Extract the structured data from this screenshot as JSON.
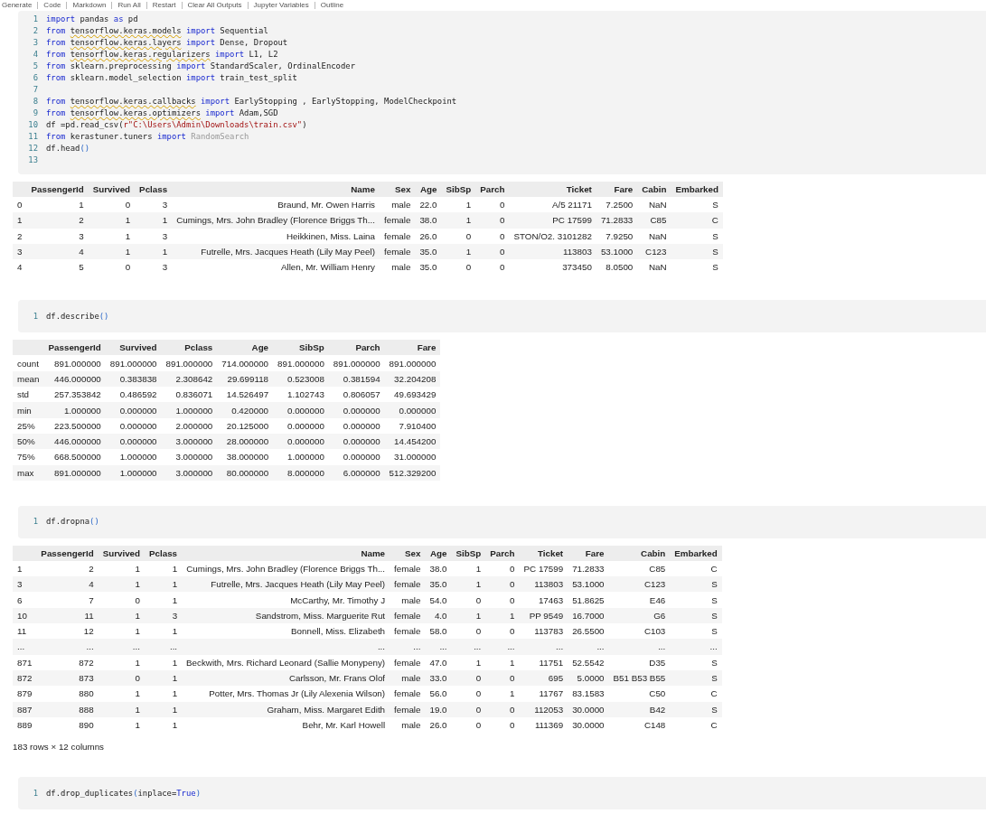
{
  "toolbar": {
    "items": [
      "Generate",
      "Code",
      "Markdown",
      "Run All",
      "Restart",
      "Clear All Outputs",
      "Jupyter Variables",
      "Outline"
    ]
  },
  "cells": [
    {
      "code_lines": [
        {
          "number": "1",
          "tokens": [
            {
              "kind": "kw",
              "text": "import"
            },
            {
              "kind": "plain",
              "text": " pandas "
            },
            {
              "kind": "kw",
              "text": "as"
            },
            {
              "kind": "plain",
              "text": " pd"
            }
          ]
        },
        {
          "number": "2",
          "tokens": [
            {
              "kind": "kw",
              "text": "from "
            },
            {
              "kind": "warn",
              "text": "tensorflow.keras.models"
            },
            {
              "kind": "kw",
              "text": " import"
            },
            {
              "kind": "plain",
              "text": " Sequential"
            }
          ]
        },
        {
          "number": "3",
          "tokens": [
            {
              "kind": "kw",
              "text": "from "
            },
            {
              "kind": "warn",
              "text": "tensorflow.keras.layers"
            },
            {
              "kind": "kw",
              "text": " import"
            },
            {
              "kind": "plain",
              "text": " Dense, Dropout"
            }
          ]
        },
        {
          "number": "4",
          "tokens": [
            {
              "kind": "kw",
              "text": "from "
            },
            {
              "kind": "warn",
              "text": "tensorflow.keras.regularizers"
            },
            {
              "kind": "kw",
              "text": " import"
            },
            {
              "kind": "plain",
              "text": " L1, L2"
            }
          ]
        },
        {
          "number": "5",
          "tokens": [
            {
              "kind": "kw",
              "text": "from"
            },
            {
              "kind": "plain",
              "text": " sklearn.preprocessing "
            },
            {
              "kind": "kw",
              "text": "import"
            },
            {
              "kind": "plain",
              "text": " StandardScaler, OrdinalEncoder"
            }
          ]
        },
        {
          "number": "6",
          "tokens": [
            {
              "kind": "kw",
              "text": "from"
            },
            {
              "kind": "plain",
              "text": " sklearn.model_selection "
            },
            {
              "kind": "kw",
              "text": "import"
            },
            {
              "kind": "plain",
              "text": " train_test_split"
            }
          ]
        },
        {
          "number": "7"
        },
        {
          "number": "8",
          "tokens": [
            {
              "kind": "kw",
              "text": "from "
            },
            {
              "kind": "warn",
              "text": "tensorflow.keras.callbacks"
            },
            {
              "kind": "kw",
              "text": " import"
            },
            {
              "kind": "plain",
              "text": " EarlyStopping , EarlyStopping, ModelCheckpoint"
            }
          ]
        },
        {
          "number": "9",
          "tokens": [
            {
              "kind": "kw",
              "text": "from "
            },
            {
              "kind": "warn",
              "text": "tensorflow.keras.optimizers"
            },
            {
              "kind": "kw",
              "text": " import"
            },
            {
              "kind": "plain",
              "text": " Adam,SGD"
            }
          ]
        },
        {
          "number": "10",
          "tokens": [
            {
              "kind": "plain",
              "text": "df =pd.read_csv("
            },
            {
              "kind": "str",
              "text": "r\"C:\\Users\\Admin\\Downloads\\train.csv\""
            },
            {
              "kind": "plain",
              "text": ")"
            }
          ]
        },
        {
          "number": "11",
          "tokens": [
            {
              "kind": "kw",
              "text": "from"
            },
            {
              "kind": "plain",
              "text": " kerastuner.tuners "
            },
            {
              "kind": "kw",
              "text": "import"
            },
            {
              "kind": "dim",
              "text": " RandomSearch"
            }
          ]
        },
        {
          "number": "12",
          "tokens": [
            {
              "kind": "plain",
              "text": "df.head"
            },
            {
              "kind": "paren",
              "text": "()"
            }
          ]
        },
        {
          "number": "13"
        }
      ],
      "output": {
        "columns": [
          "",
          "PassengerId",
          "Survived",
          "Pclass",
          "Name",
          "Sex",
          "Age",
          "SibSp",
          "Parch",
          "Ticket",
          "Fare",
          "Cabin",
          "Embarked"
        ],
        "rows": [
          [
            "0",
            "1",
            "0",
            "3",
            "Braund, Mr. Owen Harris",
            "male",
            "22.0",
            "1",
            "0",
            "A/5 21171",
            "7.2500",
            "NaN",
            "S"
          ],
          [
            "1",
            "2",
            "1",
            "1",
            "Cumings, Mrs. John Bradley (Florence Briggs Th...",
            "female",
            "38.0",
            "1",
            "0",
            "PC 17599",
            "71.2833",
            "C85",
            "C"
          ],
          [
            "2",
            "3",
            "1",
            "3",
            "Heikkinen, Miss. Laina",
            "female",
            "26.0",
            "0",
            "0",
            "STON/O2. 3101282",
            "7.9250",
            "NaN",
            "S"
          ],
          [
            "3",
            "4",
            "1",
            "1",
            "Futrelle, Mrs. Jacques Heath (Lily May Peel)",
            "female",
            "35.0",
            "1",
            "0",
            "113803",
            "53.1000",
            "C123",
            "S"
          ],
          [
            "4",
            "5",
            "0",
            "3",
            "Allen, Mr. William Henry",
            "male",
            "35.0",
            "0",
            "0",
            "373450",
            "8.0500",
            "NaN",
            "S"
          ]
        ]
      }
    },
    {
      "code_lines": [
        {
          "number": "1",
          "tokens": [
            {
              "kind": "plain",
              "text": "df.describe"
            },
            {
              "kind": "paren",
              "text": "()"
            }
          ]
        }
      ],
      "output": {
        "columns": [
          "",
          "PassengerId",
          "Survived",
          "Pclass",
          "Age",
          "SibSp",
          "Parch",
          "Fare"
        ],
        "rows": [
          [
            "count",
            "891.000000",
            "891.000000",
            "891.000000",
            "714.000000",
            "891.000000",
            "891.000000",
            "891.000000"
          ],
          [
            "mean",
            "446.000000",
            "0.383838",
            "2.308642",
            "29.699118",
            "0.523008",
            "0.381594",
            "32.204208"
          ],
          [
            "std",
            "257.353842",
            "0.486592",
            "0.836071",
            "14.526497",
            "1.102743",
            "0.806057",
            "49.693429"
          ],
          [
            "min",
            "1.000000",
            "0.000000",
            "1.000000",
            "0.420000",
            "0.000000",
            "0.000000",
            "0.000000"
          ],
          [
            "25%",
            "223.500000",
            "0.000000",
            "2.000000",
            "20.125000",
            "0.000000",
            "0.000000",
            "7.910400"
          ],
          [
            "50%",
            "446.000000",
            "0.000000",
            "3.000000",
            "28.000000",
            "0.000000",
            "0.000000",
            "14.454200"
          ],
          [
            "75%",
            "668.500000",
            "1.000000",
            "3.000000",
            "38.000000",
            "1.000000",
            "0.000000",
            "31.000000"
          ],
          [
            "max",
            "891.000000",
            "1.000000",
            "3.000000",
            "80.000000",
            "8.000000",
            "6.000000",
            "512.329200"
          ]
        ]
      }
    },
    {
      "code_lines": [
        {
          "number": "1",
          "tokens": [
            {
              "kind": "plain",
              "text": "df.dropna"
            },
            {
              "kind": "paren",
              "text": "()"
            }
          ]
        }
      ],
      "output": {
        "columns": [
          "",
          "PassengerId",
          "Survived",
          "Pclass",
          "Name",
          "Sex",
          "Age",
          "SibSp",
          "Parch",
          "Ticket",
          "Fare",
          "Cabin",
          "Embarked"
        ],
        "rows": [
          [
            "1",
            "2",
            "1",
            "1",
            "Cumings, Mrs. John Bradley (Florence Briggs Th...",
            "female",
            "38.0",
            "1",
            "0",
            "PC 17599",
            "71.2833",
            "C85",
            "C"
          ],
          [
            "3",
            "4",
            "1",
            "1",
            "Futrelle, Mrs. Jacques Heath (Lily May Peel)",
            "female",
            "35.0",
            "1",
            "0",
            "113803",
            "53.1000",
            "C123",
            "S"
          ],
          [
            "6",
            "7",
            "0",
            "1",
            "McCarthy, Mr. Timothy J",
            "male",
            "54.0",
            "0",
            "0",
            "17463",
            "51.8625",
            "E46",
            "S"
          ],
          [
            "10",
            "11",
            "1",
            "3",
            "Sandstrom, Miss. Marguerite Rut",
            "female",
            "4.0",
            "1",
            "1",
            "PP 9549",
            "16.7000",
            "G6",
            "S"
          ],
          [
            "11",
            "12",
            "1",
            "1",
            "Bonnell, Miss. Elizabeth",
            "female",
            "58.0",
            "0",
            "0",
            "113783",
            "26.5500",
            "C103",
            "S"
          ],
          [
            "...",
            "...",
            "...",
            "...",
            "...",
            "...",
            "...",
            "...",
            "...",
            "...",
            "...",
            "...",
            "..."
          ],
          [
            "871",
            "872",
            "1",
            "1",
            "Beckwith, Mrs. Richard Leonard (Sallie Monypeny)",
            "female",
            "47.0",
            "1",
            "1",
            "11751",
            "52.5542",
            "D35",
            "S"
          ],
          [
            "872",
            "873",
            "0",
            "1",
            "Carlsson, Mr. Frans Olof",
            "male",
            "33.0",
            "0",
            "0",
            "695",
            "5.0000",
            "B51 B53 B55",
            "S"
          ],
          [
            "879",
            "880",
            "1",
            "1",
            "Potter, Mrs. Thomas Jr (Lily Alexenia Wilson)",
            "female",
            "56.0",
            "0",
            "1",
            "11767",
            "83.1583",
            "C50",
            "C"
          ],
          [
            "887",
            "888",
            "1",
            "1",
            "Graham, Miss. Margaret Edith",
            "female",
            "19.0",
            "0",
            "0",
            "112053",
            "30.0000",
            "B42",
            "S"
          ],
          [
            "889",
            "890",
            "1",
            "1",
            "Behr, Mr. Karl Howell",
            "male",
            "26.0",
            "0",
            "0",
            "111369",
            "30.0000",
            "C148",
            "C"
          ]
        ],
        "footer": "183 rows × 12 columns"
      }
    },
    {
      "code_lines": [
        {
          "number": "1",
          "tokens": [
            {
              "kind": "plain",
              "text": "df.drop_duplicates"
            },
            {
              "kind": "paren",
              "text": "("
            },
            {
              "kind": "plain",
              "text": "inplace="
            },
            {
              "kind": "kw",
              "text": "True"
            },
            {
              "kind": "paren",
              "text": ")"
            }
          ]
        }
      ]
    }
  ]
}
